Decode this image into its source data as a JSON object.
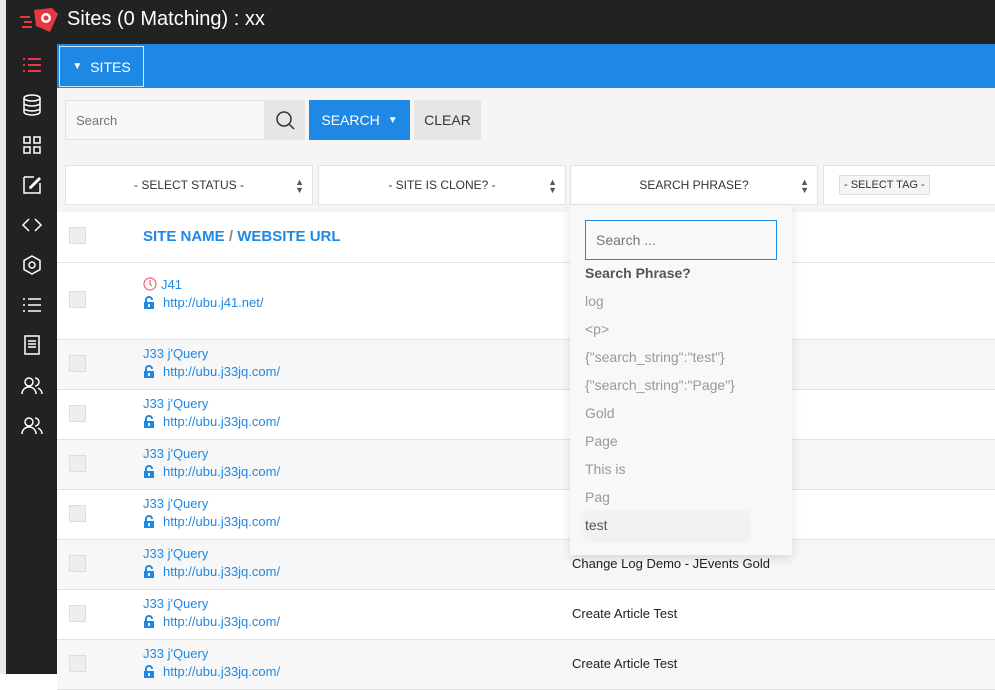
{
  "header": {
    "title": "Sites (0 Matching) : xx"
  },
  "colors": {
    "accent": "#1e88e5",
    "sidebar": "#222222",
    "logo": "#e53940"
  },
  "sidebar": {
    "items": [
      {
        "icon": "list-icon",
        "active": true
      },
      {
        "icon": "database-icon"
      },
      {
        "icon": "grid-icon"
      },
      {
        "icon": "edit-icon"
      },
      {
        "icon": "code-icon"
      },
      {
        "icon": "hexagon-icon"
      },
      {
        "icon": "list-icon"
      },
      {
        "icon": "document-icon"
      },
      {
        "icon": "users-icon"
      },
      {
        "icon": "users-icon"
      }
    ]
  },
  "toolbar": {
    "sites_label": "SITES"
  },
  "search": {
    "placeholder": "Search",
    "search_label": "SEARCH",
    "clear_label": "CLEAR"
  },
  "filters": {
    "status": "- SELECT STATUS -",
    "clone": "- SITE IS CLONE? -",
    "phrase": "SEARCH PHRASE?",
    "tag": "- SELECT TAG -"
  },
  "table": {
    "header": {
      "name": "SITE NAME",
      "sep": " / ",
      "url": "WEBSITE URL"
    },
    "rows": [
      {
        "name": "J41",
        "url": "http://ubu.j41.net/",
        "col3": ""
      },
      {
        "name": "J33 j'Query",
        "url": "http://ubu.j33jq.com/",
        "col3": ""
      },
      {
        "name": "J33 j'Query",
        "url": "http://ubu.j33jq.com/",
        "col3": ""
      },
      {
        "name": "J33 j'Query",
        "url": "http://ubu.j33jq.com/",
        "col3": ""
      },
      {
        "name": "J33 j'Query",
        "url": "http://ubu.j33jq.com/",
        "col3": ""
      },
      {
        "name": "J33 j'Query",
        "url": "http://ubu.j33jq.com/",
        "col3": "Change Log Demo - JEvents Gold"
      },
      {
        "name": "J33 j'Query",
        "url": "http://ubu.j33jq.com/",
        "col3": "Create Article Test"
      },
      {
        "name": "J33 j'Query",
        "url": "http://ubu.j33jq.com/",
        "col3": "Create Article Test"
      }
    ]
  },
  "dropdown": {
    "placeholder": "Search ...",
    "heading": "Search Phrase?",
    "options": [
      "log",
      "<p>",
      "{\"search_string\":\"test\"}",
      "{\"search_string\":\"Page\"}",
      "Gold",
      "Page",
      "This is",
      "Pag",
      "test"
    ],
    "highlighted": "test"
  }
}
